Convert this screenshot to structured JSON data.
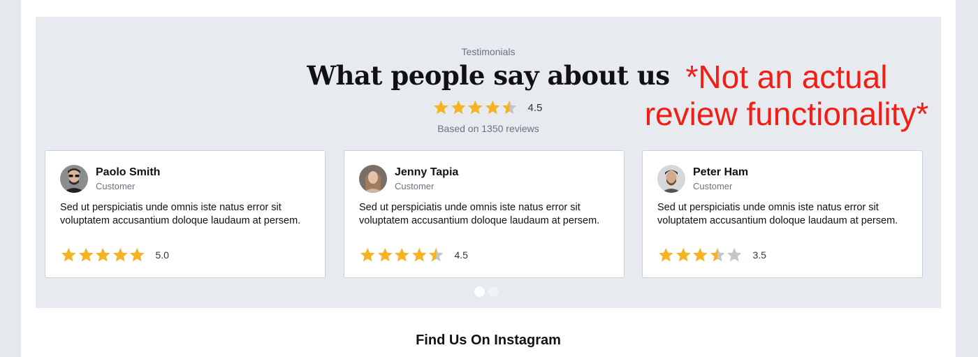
{
  "testimonials": {
    "eyebrow": "Testimonials",
    "title": "What people say about us",
    "summary_rating": 4.5,
    "summary_rating_label": "4.5",
    "based_on": "Based on 1350 reviews",
    "disclaimer_line1": "*Not an actual",
    "disclaimer_line2": "review functionality*",
    "reviews": [
      {
        "name": "Paolo Smith",
        "role": "Customer",
        "text": "Sed ut perspiciatis unde omnis iste natus error sit voluptatem accusantium doloque laudaum at persem.",
        "rating": 5.0,
        "rating_label": "5.0"
      },
      {
        "name": "Jenny Tapia",
        "role": "Customer",
        "text": "Sed ut perspiciatis unde omnis iste natus error sit voluptatem accusantium doloque laudaum at persem.",
        "rating": 4.5,
        "rating_label": "4.5"
      },
      {
        "name": "Peter Ham",
        "role": "Customer",
        "text": "Sed ut perspiciatis unde omnis iste natus error sit voluptatem accusantium doloque laudaum at persem.",
        "rating": 3.5,
        "rating_label": "3.5"
      }
    ],
    "carousel_pages": 2,
    "carousel_active_page": 1
  },
  "instagram": {
    "title": "Find Us On Instagram"
  },
  "colors": {
    "star_filled": "#f5b323",
    "star_empty": "#c2c5ca",
    "disclaimer": "#f21d14",
    "section_bg": "#e7ebef"
  }
}
